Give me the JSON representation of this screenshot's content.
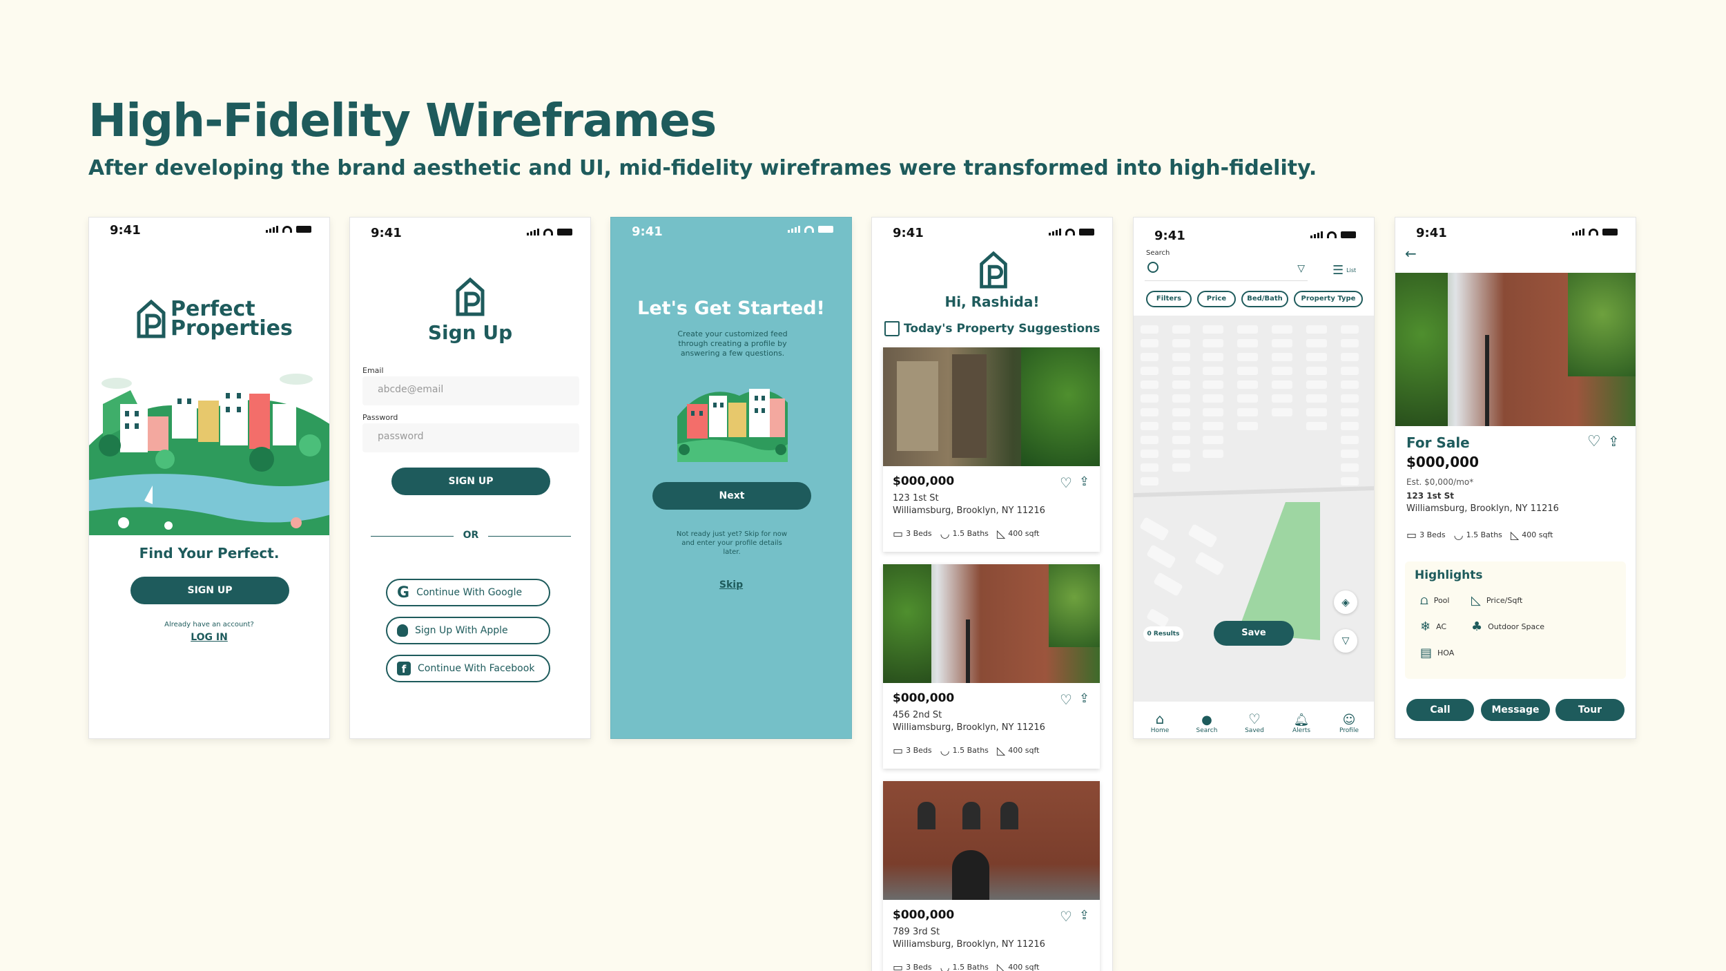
{
  "page": {
    "title": "High-Fidelity Wireframes",
    "subtitle": "After developing the brand aesthetic and UI, mid-fidelity wireframes were transformed into high-fidelity."
  },
  "colors": {
    "brand": "#1e5b5c",
    "background": "#fdfbf0",
    "teal": "#75c0c8",
    "map_park": "#9ed6a2"
  },
  "status_time": "9:41",
  "screen1": {
    "logo_line1": "Perfect",
    "logo_line2": "Properties",
    "tagline": "Find Your Perfect.",
    "signup_label": "SIGN UP",
    "account_text": "Already have an account?",
    "login_label": "LOG IN"
  },
  "screen2": {
    "title": "Sign Up",
    "email_label": "Email",
    "email_placeholder": "abcde@email",
    "password_label": "Password",
    "password_placeholder": "password",
    "signup_label": "SIGN UP",
    "or_label": "OR",
    "google_label": "Continue With Google",
    "apple_label": "Sign Up With Apple",
    "facebook_label": "Continue With Facebook"
  },
  "screen3": {
    "title": "Let's Get Started!",
    "description": "Create your customized feed through creating a profile by answering a few questions.",
    "next_label": "Next",
    "skip_text": "Not ready just yet? Skip for now and enter your profile details later.",
    "skip_label": "Skip"
  },
  "screen4": {
    "greeting": "Hi, Rashida!",
    "section_title": "Today's Property Suggestions",
    "listings": [
      {
        "price": "$000,000",
        "street": "123 1st St",
        "city": "Williamsburg, Brooklyn, NY 11216",
        "beds": "3 Beds",
        "baths": "1.5 Baths",
        "sqft": "400 sqft"
      },
      {
        "price": "$000,000",
        "street": "456 2nd St",
        "city": "Williamsburg, Brooklyn, NY 11216",
        "beds": "3 Beds",
        "baths": "1.5 Baths",
        "sqft": "400 sqft"
      },
      {
        "price": "$000,000",
        "street": "789 3rd St",
        "city": "Williamsburg, Brooklyn, NY 11216",
        "beds": "3 Beds",
        "baths": "1.5 Baths",
        "sqft": "400 sqft"
      }
    ]
  },
  "screen5": {
    "search_label": "Search",
    "list_label": "List",
    "filters": [
      "Filters",
      "Price",
      "Bed/Bath",
      "Property Type"
    ],
    "results_label": "0 Results",
    "save_label": "Save",
    "nav": [
      "Home",
      "Search",
      "Saved",
      "Alerts",
      "Profile"
    ]
  },
  "screen6": {
    "status": "For Sale",
    "price": "$000,000",
    "est": "Est. $0,000/mo*",
    "street": "123 1st St",
    "city": "Williamsburg, Brooklyn, NY 11216",
    "beds": "3 Beds",
    "baths": "1.5 Baths",
    "sqft": "400 sqft",
    "highlights_title": "Highlights",
    "highlights": [
      "Pool",
      "Price/Sqft",
      "AC",
      "Outdoor Space",
      "HOA"
    ],
    "call_label": "Call",
    "message_label": "Message",
    "tour_label": "Tour"
  }
}
